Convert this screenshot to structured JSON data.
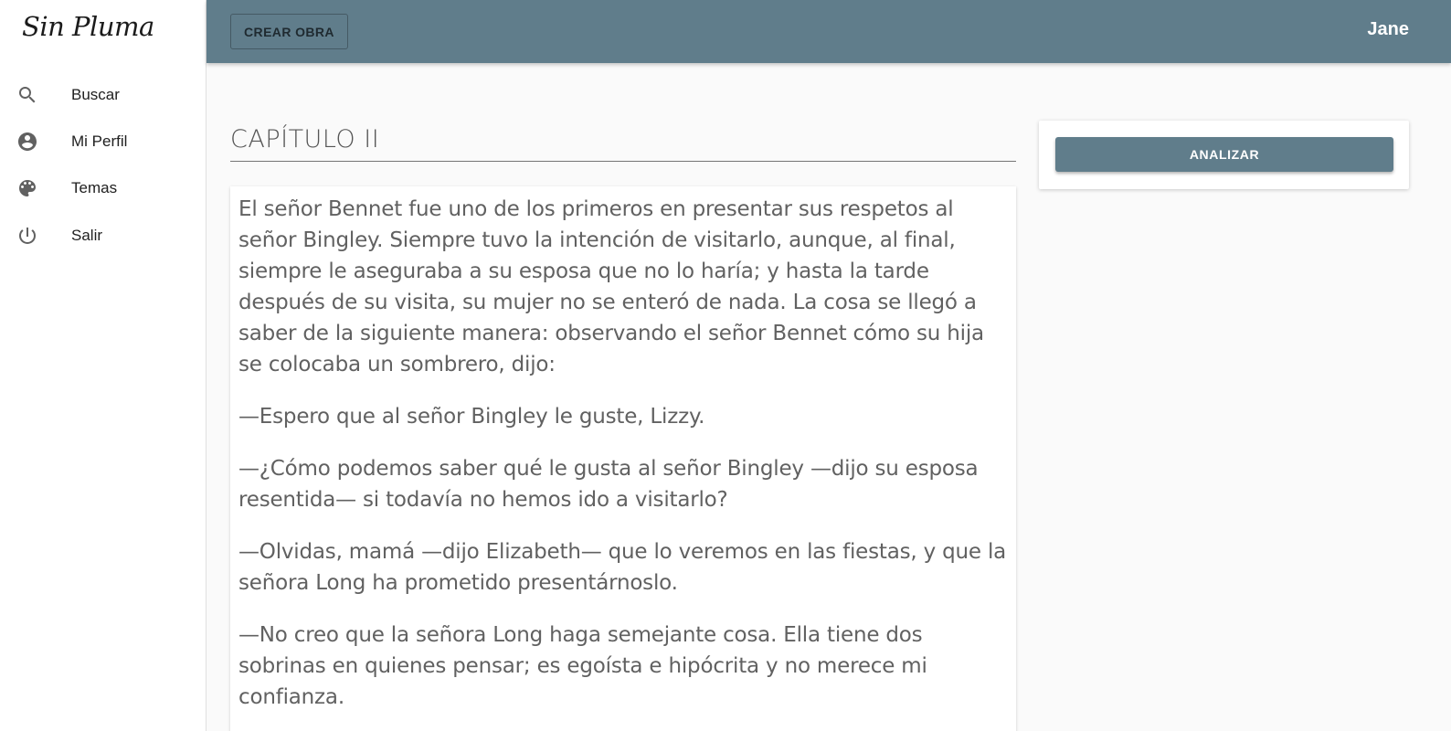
{
  "app": {
    "logo": "Sin Pluma"
  },
  "sidebar": {
    "items": [
      {
        "label": "Buscar",
        "icon": "search-icon"
      },
      {
        "label": "Mi Perfil",
        "icon": "account-circle-icon"
      },
      {
        "label": "Temas",
        "icon": "palette-icon"
      },
      {
        "label": "Salir",
        "icon": "power-icon"
      }
    ]
  },
  "topbar": {
    "create_label": "CREAR OBRA",
    "user": "Jane"
  },
  "chapter": {
    "title": "CAPÍTULO II",
    "paragraphs": [
      "El señor Bennet fue uno de los primeros en presentar sus respetos al señor Bingley. Siempre tuvo la intención de visitarlo, aunque, al final, siempre le aseguraba a su esposa que no lo haría; y hasta la tarde después de su visita, su mujer no se enteró de nada. La cosa se llegó a saber de la siguiente manera: observando el señor Bennet cómo su hija se colocaba un sombrero, dijo:",
      "—Espero que al señor Bingley le guste, Lizzy.",
      "—¿Cómo podemos saber qué le gusta al señor Bingley —dijo su esposa resentida— si todavía no hemos ido a visitarlo?",
      "—Olvidas, mamá —dijo Elizabeth— que lo veremos en las fiestas, y que la señora Long ha prometido presentárnoslo.",
      "—No creo que la señora Long haga semejante cosa. Ella tiene dos sobrinas en quienes pensar; es egoísta e hipócrita y no merece mi confianza."
    ]
  },
  "analysis": {
    "analyze_label": "ANALIZAR"
  },
  "colors": {
    "primary": "#607d8b",
    "background": "#fafafa"
  }
}
